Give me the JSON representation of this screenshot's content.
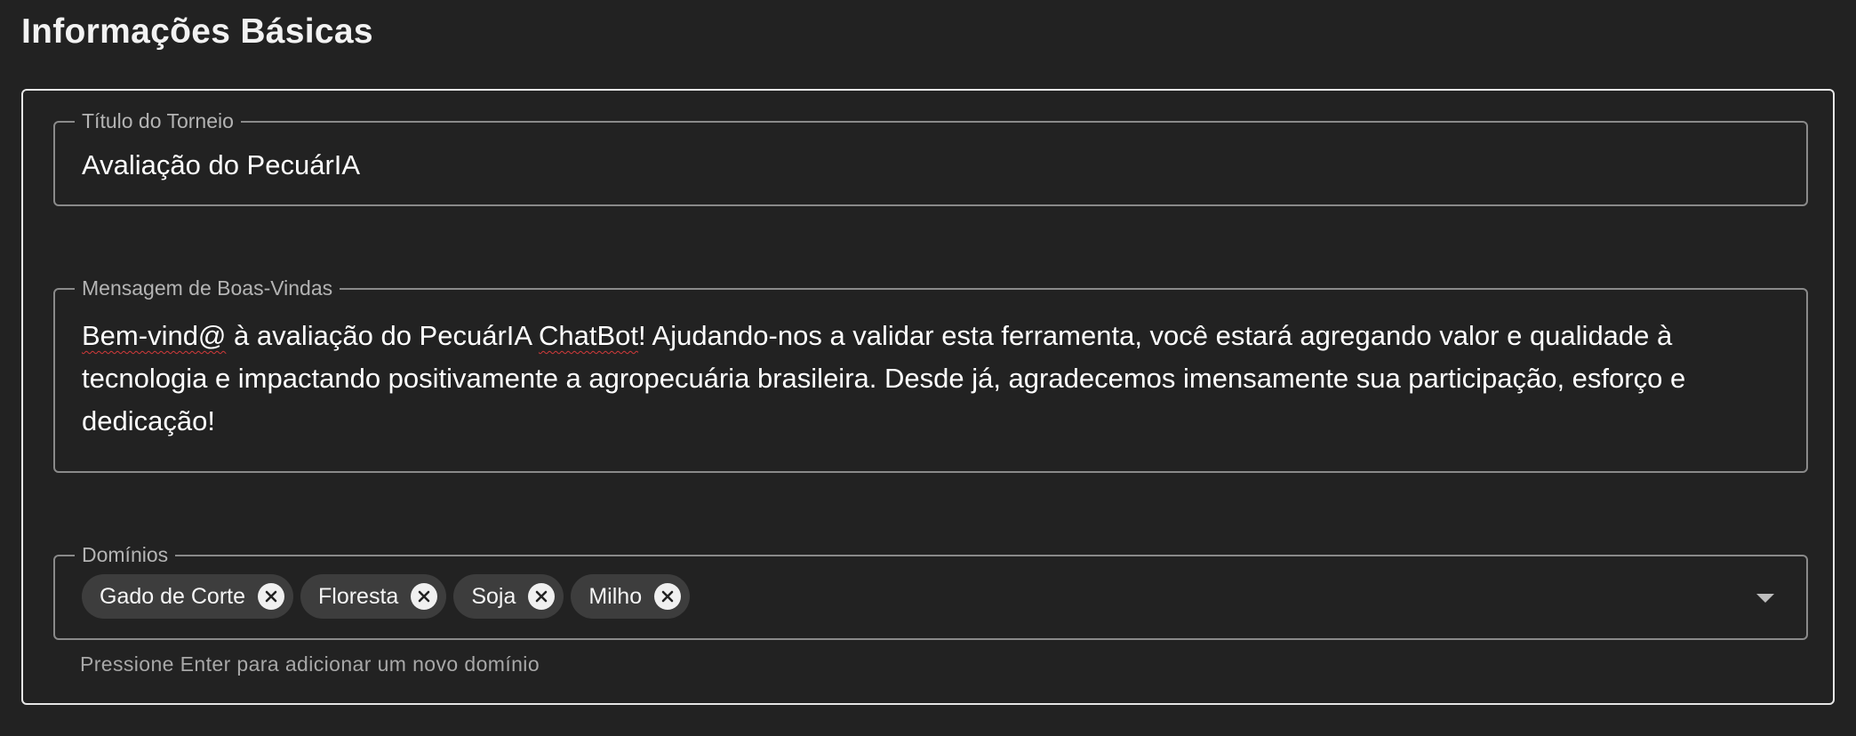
{
  "section": {
    "title": "Informações Básicas"
  },
  "title_field": {
    "label": "Título do Torneio",
    "value": "Avaliação do PecuárIA"
  },
  "welcome_field": {
    "label": "Mensagem de Boas-Vindas",
    "value_part1": "Bem-vind@",
    "value_part2": " à avaliação do PecuárIA ",
    "value_part3": "ChatBot",
    "value_part4": "! Ajudando-nos a validar esta ferramenta, você estará agregando valor e qualidade à tecnologia e impactando positivamente a agropecuária brasileira. Desde já, agradecemos imensamente sua participação, esforço e dedicação!"
  },
  "domains_field": {
    "label": "Domínios",
    "chips": [
      {
        "label": "Gado de Corte"
      },
      {
        "label": "Floresta"
      },
      {
        "label": "Soja"
      },
      {
        "label": "Milho"
      }
    ],
    "helper": "Pressione Enter para adicionar um novo domínio"
  },
  "icons": {
    "chip_remove": "close-circle-icon",
    "dropdown": "arrow-drop-down-icon"
  },
  "colors": {
    "background": "#222222",
    "border": "#8a8a8a",
    "card_border": "#e6e6e6",
    "chip_bg": "#3d3d3d"
  }
}
